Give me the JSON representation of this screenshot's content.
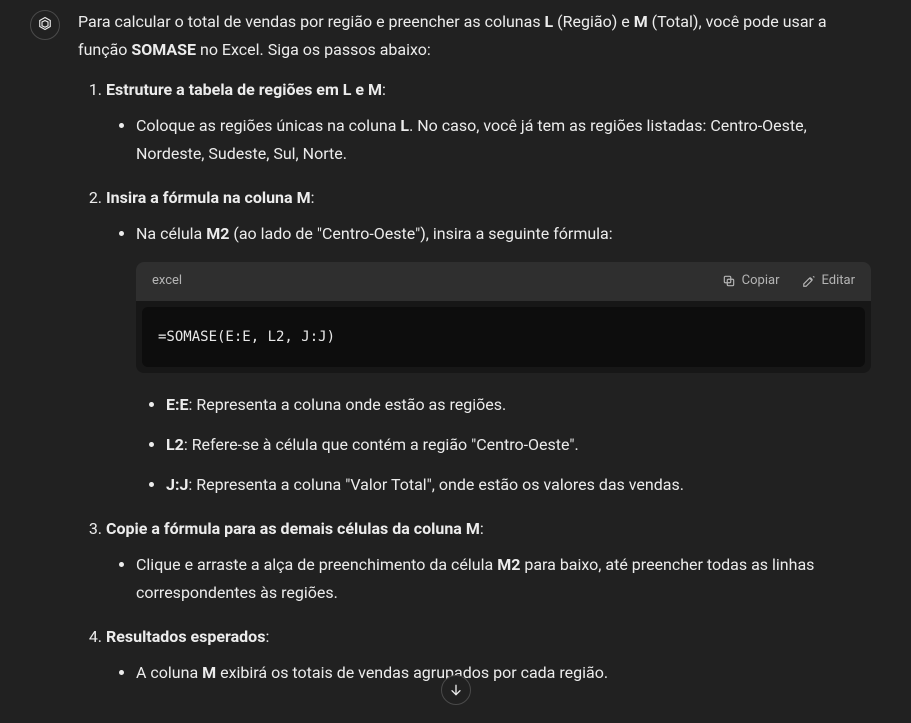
{
  "intro": {
    "pre": "Para calcular o total de vendas por região e preencher as colunas ",
    "b1": "L",
    "mid1": " (Região) e ",
    "b2": "M",
    "mid2": " (Total), você pode usar a função ",
    "b3": "SOMASE",
    "post": " no Excel. Siga os passos abaixo:"
  },
  "steps": {
    "s1": {
      "head_pre": "Estruture a tabela de regiões em ",
      "head_b1": "L e M",
      "head_post": ":",
      "bullet_pre": "Coloque as regiões únicas na coluna ",
      "bullet_b": "L",
      "bullet_post": ". No caso, você já tem as regiões listadas: Centro-Oeste, Nordeste, Sudeste, Sul, Norte."
    },
    "s2": {
      "head_pre": "Insira a fórmula na coluna ",
      "head_b": "M",
      "head_post": ":",
      "bullet1_pre": "Na célula ",
      "bullet1_b": "M2",
      "bullet1_post": " (ao lado de \"Centro-Oeste\"), insira a seguinte fórmula:",
      "code_lang": "excel",
      "copy_label": "Copiar",
      "edit_label": "Editar",
      "code_text": "=SOMASE(E:E, L2, J:J)",
      "expl1_b": "E:E",
      "expl1_t": ": Representa a coluna onde estão as regiões.",
      "expl2_b": "L2",
      "expl2_t": ": Refere-se à célula que contém a região \"Centro-Oeste\".",
      "expl3_b": "J:J",
      "expl3_t": ": Representa a coluna \"Valor Total\", onde estão os valores das vendas."
    },
    "s3": {
      "head": "Copie a fórmula para as demais células da coluna M",
      "head_post": ":",
      "bullet_pre": "Clique e arraste a alça de preenchimento da célula ",
      "bullet_b": "M2",
      "bullet_post": " para baixo, até preencher todas as linhas correspondentes às regiões."
    },
    "s4": {
      "head": "Resultados esperados",
      "head_post": ":",
      "bullet_pre": "A coluna ",
      "bullet_b": "M",
      "bullet_post": " exibirá os totais de vendas agrupados por cada região."
    }
  }
}
